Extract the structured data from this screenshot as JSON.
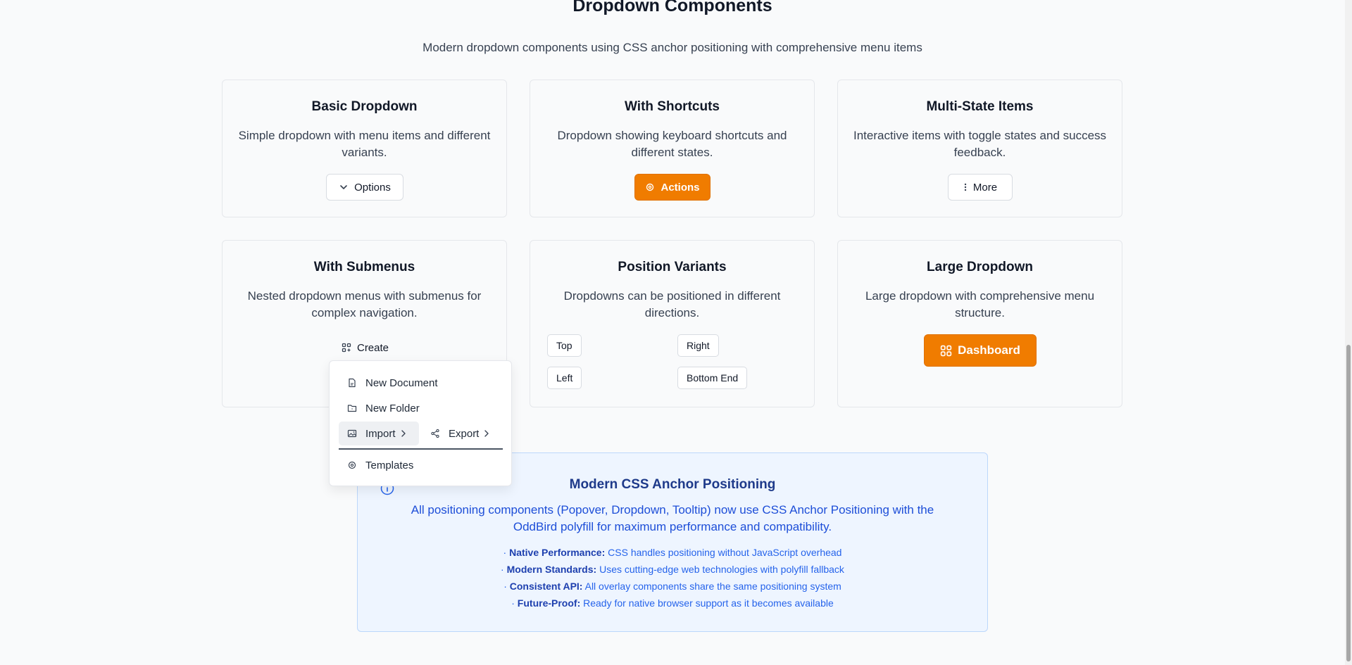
{
  "header": {
    "title": "Dropdown Components",
    "subtitle": "Modern dropdown components using CSS anchor positioning with comprehensive menu items"
  },
  "cards": {
    "basic": {
      "title": "Basic Dropdown",
      "desc": "Simple dropdown with menu items and different variants.",
      "button": "Options"
    },
    "shortcuts": {
      "title": "With Shortcuts",
      "desc": "Dropdown showing keyboard shortcuts and different states.",
      "button": "Actions"
    },
    "multistate": {
      "title": "Multi-State Items",
      "desc": "Interactive items with toggle states and success feedback.",
      "button": "More"
    },
    "submenus": {
      "title": "With Submenus",
      "desc": "Nested dropdown menus with submenus for complex navigation.",
      "button": "Create"
    },
    "positions": {
      "title": "Position Variants",
      "desc": "Dropdowns can be positioned in different directions.",
      "buttons": {
        "top": "Top",
        "right": "Right",
        "left": "Left",
        "bottom_end": "Bottom End"
      }
    },
    "large": {
      "title": "Large Dropdown",
      "desc": "Large dropdown with comprehensive menu structure.",
      "button": "Dashboard"
    }
  },
  "menu": {
    "new_document": "New Document",
    "new_folder": "New Folder",
    "import": "Import",
    "export": "Export",
    "templates": "Templates"
  },
  "info": {
    "title": "Modern CSS Anchor Positioning",
    "desc": "All positioning components (Popover, Dropdown, Tooltip) now use CSS Anchor Positioning with the OddBird polyfill for maximum performance and compatibility.",
    "items": [
      {
        "bullet": "·",
        "label": "Native Performance:",
        "text": "CSS handles positioning without JavaScript overhead"
      },
      {
        "bullet": "·",
        "label": "Modern Standards:",
        "text": "Uses cutting-edge web technologies with polyfill fallback"
      },
      {
        "bullet": "·",
        "label": "Consistent API:",
        "text": "All overlay components share the same positioning system"
      },
      {
        "bullet": "·",
        "label": "Future-Proof:",
        "text": "Ready for native browser support as it becomes available"
      }
    ]
  },
  "colors": {
    "primary": "#f07c00",
    "info_bg": "#eef5ff",
    "info_text": "#1d4ed8"
  }
}
